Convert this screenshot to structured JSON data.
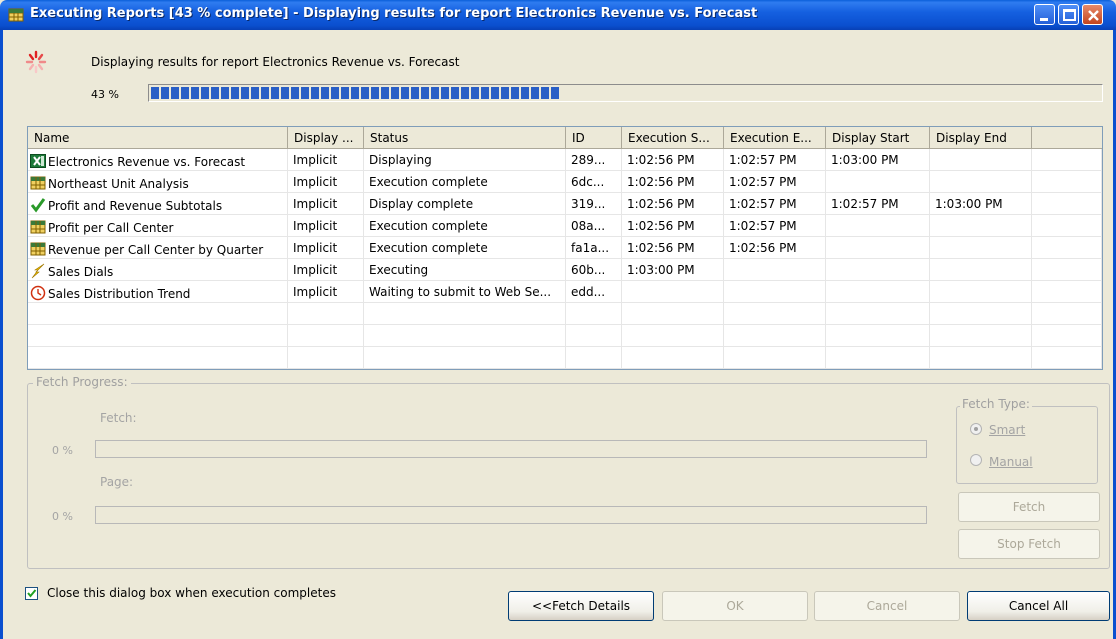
{
  "window": {
    "title": "Executing Reports [43 % complete] - Displaying results for report Electronics Revenue vs. Forecast"
  },
  "header": {
    "status_message": "Displaying results for report Electronics Revenue vs. Forecast",
    "percent_label": "43 %",
    "progress_fraction": 0.43
  },
  "list": {
    "columns": [
      "Name",
      "Display ...",
      "Status",
      "ID",
      "Execution S...",
      "Execution E...",
      "Display Start",
      "Display End"
    ],
    "rows": [
      {
        "icon": "excel-icon",
        "name": "Electronics Revenue vs. Forecast",
        "display": "Implicit",
        "status": "Displaying",
        "id": "289...",
        "exec_start": "1:02:56 PM",
        "exec_end": "1:02:57 PM",
        "disp_start": "1:03:00 PM",
        "disp_end": ""
      },
      {
        "icon": "grid-report-icon",
        "name": "Northeast Unit Analysis",
        "display": "Implicit",
        "status": "Execution complete",
        "id": "6dc...",
        "exec_start": "1:02:56 PM",
        "exec_end": "1:02:57 PM",
        "disp_start": "",
        "disp_end": ""
      },
      {
        "icon": "checkmark-icon",
        "name": "Profit and Revenue Subtotals",
        "display": "Implicit",
        "status": "Display complete",
        "id": "319...",
        "exec_start": "1:02:56 PM",
        "exec_end": "1:02:57 PM",
        "disp_start": "1:02:57 PM",
        "disp_end": "1:03:00 PM"
      },
      {
        "icon": "grid-report-icon",
        "name": "Profit per Call Center",
        "display": "Implicit",
        "status": "Execution complete",
        "id": "08a...",
        "exec_start": "1:02:56 PM",
        "exec_end": "1:02:57 PM",
        "disp_start": "",
        "disp_end": ""
      },
      {
        "icon": "grid-report-icon",
        "name": "Revenue per Call Center by Quarter",
        "display": "Implicit",
        "status": "Execution complete",
        "id": "fa1a...",
        "exec_start": "1:02:56 PM",
        "exec_end": "1:02:56 PM",
        "disp_start": "",
        "disp_end": ""
      },
      {
        "icon": "lightning-icon",
        "name": "Sales Dials",
        "display": "Implicit",
        "status": "Executing",
        "id": "60b...",
        "exec_start": "1:03:00 PM",
        "exec_end": "",
        "disp_start": "",
        "disp_end": ""
      },
      {
        "icon": "clock-icon",
        "name": "Sales Distribution Trend",
        "display": "Implicit",
        "status": "Waiting to submit to Web Se...",
        "id": "edd...",
        "exec_start": "",
        "exec_end": "",
        "disp_start": "",
        "disp_end": ""
      }
    ]
  },
  "fetch": {
    "group_title": "Fetch Progress:",
    "fetch_label": "Fetch:",
    "fetch_percent": "0 %",
    "fetch_fraction": 0,
    "page_label": "Page:",
    "page_percent": "0 %",
    "page_fraction": 0,
    "type_title": "Fetch Type:",
    "smart_label": "Smart",
    "manual_label": "Manual",
    "selected_type": "Smart",
    "fetch_button": "Fetch",
    "stop_button": "Stop Fetch"
  },
  "footer": {
    "close_checkbox_label": "Close this dialog box when execution completes",
    "close_checked": true,
    "details_button": "<<Fetch Details",
    "ok_button": "OK",
    "cancel_button": "Cancel",
    "cancel_all_button": "Cancel All"
  }
}
